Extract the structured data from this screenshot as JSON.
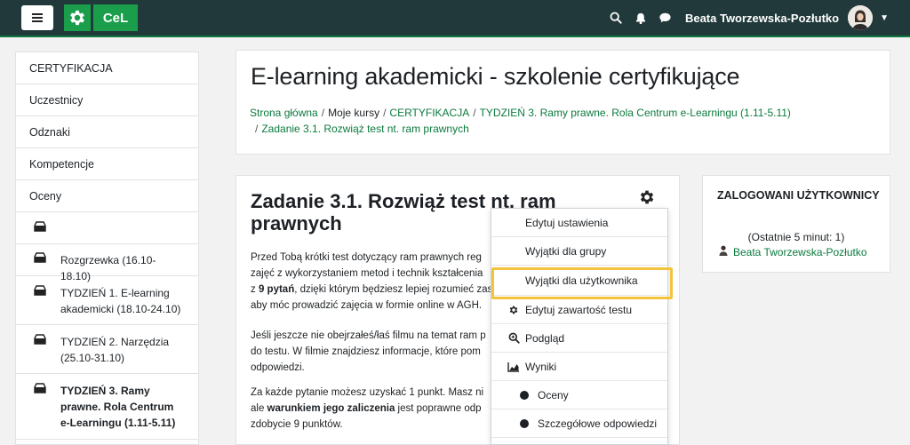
{
  "navbar": {
    "logo_text": "CeL",
    "user_name": "Beata Tworzewska-Pozłutko"
  },
  "sidebar": {
    "items": [
      {
        "label": "CERTYFIKACJA"
      },
      {
        "label": "Uczestnicy"
      },
      {
        "label": "Odznaki"
      },
      {
        "label": "Kompetencje"
      },
      {
        "label": "Oceny"
      }
    ],
    "sections": [
      {
        "label": ""
      },
      {
        "label": "Rozgrzewka (16.10-18.10)"
      },
      {
        "label": "TYDZIEŃ 1. E-learning akademicki (18.10-24.10)"
      },
      {
        "label": "TYDZIEŃ 2. Narzędzia (25.10-31.10)"
      },
      {
        "label": "TYDZIEŃ 3. Ramy prawne. Rola Centrum e-Learningu (1.11-5.11)"
      }
    ]
  },
  "header": {
    "title": "E-learning akademicki - szkolenie certyfikujące",
    "breadcrumbs": [
      {
        "label": "Strona główna"
      },
      {
        "label": "Moje kursy"
      },
      {
        "label": "CERTYFIKACJA"
      },
      {
        "label": "TYDZIEŃ 3. Ramy prawne. Rola Centrum e-Learningu (1.11-5.11)"
      },
      {
        "label": "Zadanie 3.1. Rozwiąż test nt. ram prawnych"
      }
    ]
  },
  "activity": {
    "title": "Zadanie 3.1. Rozwiąż test nt. ram prawnych",
    "p1": {
      "l1": "Przed Tobą krótki test dotyczący ram prawnych reg",
      "l2": "zajęć z wykorzystaniem metod i technik kształcenia",
      "l3_pre": "z ",
      "l3_bold": "9 pytań",
      "l3_post": ", dzięki którym będziesz lepiej rozumieć zas",
      "l4": "aby móc prowadzić zajęcia w formie online w AGH."
    },
    "p2": {
      "l1": "Jeśli jeszcze nie obejrzałeś/łaś filmu na temat ram p",
      "l2": "do testu. W filmie  znajdziesz informacje, które pom",
      "l3": "odpowiedzi."
    },
    "p3": {
      "l1": "Za każde pytanie możesz uzyskać 1 punkt. Masz ni",
      "l2_pre": "ale ",
      "l2_bold": "warunkiem jego zaliczenia",
      "l2_post": " jest poprawne odp",
      "l3": "zdobycie 9 punktów."
    }
  },
  "menu": {
    "items": [
      {
        "label": "Edytuj ustawienia"
      },
      {
        "label": "Wyjątki dla grupy"
      },
      {
        "label": "Wyjątki dla użytkownika"
      },
      {
        "label": "Edytuj zawartość testu"
      },
      {
        "label": "Podgląd"
      },
      {
        "label": "Wyniki"
      },
      {
        "label": "Oceny"
      },
      {
        "label": "Szczegółowe odpowiedzi"
      }
    ]
  },
  "online_block": {
    "title": "ZALOGOWANI UŻYTKOWNICY",
    "subtitle": "(Ostatnie 5 minut: 1)",
    "user": "Beata Tworzewska-Pozłutko"
  },
  "colors": {
    "navbar": "#21393a",
    "accent_green": "#1a9e4b",
    "link_green": "#0b7a3e",
    "highlight": "#f3c33c"
  }
}
